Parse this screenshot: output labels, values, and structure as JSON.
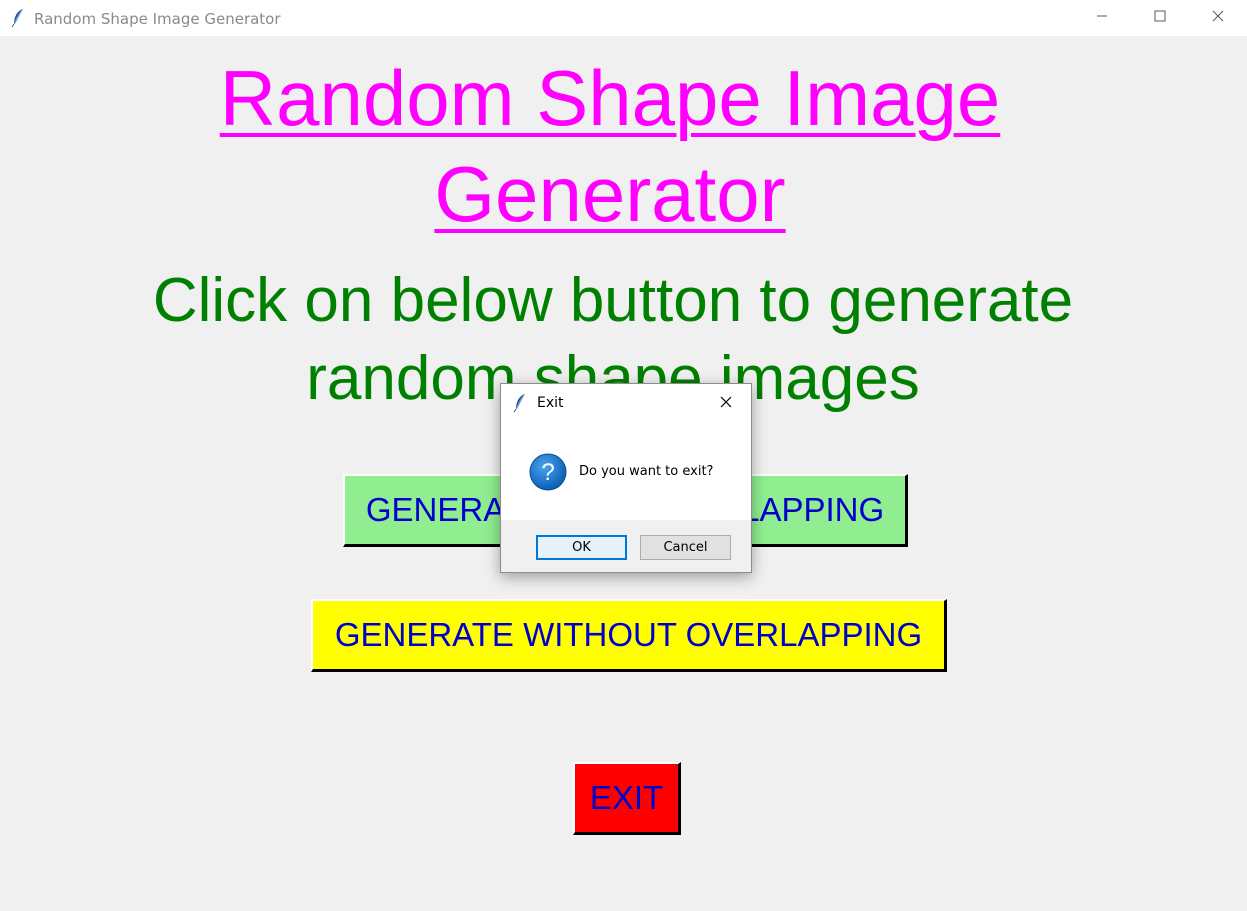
{
  "window": {
    "title": "Random Shape Image Generator"
  },
  "main": {
    "heading_line1": "Random Shape Image",
    "heading_line2": "Generator",
    "subheading_line1": "Click on below button to generate",
    "subheading_line2": "random shape images",
    "buttons": {
      "generate_overlap": "GENERATE WITH OVERLAPPING",
      "generate_no_overlap": "GENERATE WITHOUT OVERLAPPING",
      "exit": "EXIT"
    }
  },
  "dialog": {
    "title": "Exit",
    "message": "Do you want to exit?",
    "ok_label": "OK",
    "cancel_label": "Cancel",
    "icon": "question-icon"
  },
  "colors": {
    "heading": "#ff00ff",
    "subheading": "#008000",
    "button_text": "#0000cc",
    "overlap_button_bg": "#90ee90",
    "no_overlap_button_bg": "#ffff00",
    "exit_button_bg": "#ff0000"
  }
}
